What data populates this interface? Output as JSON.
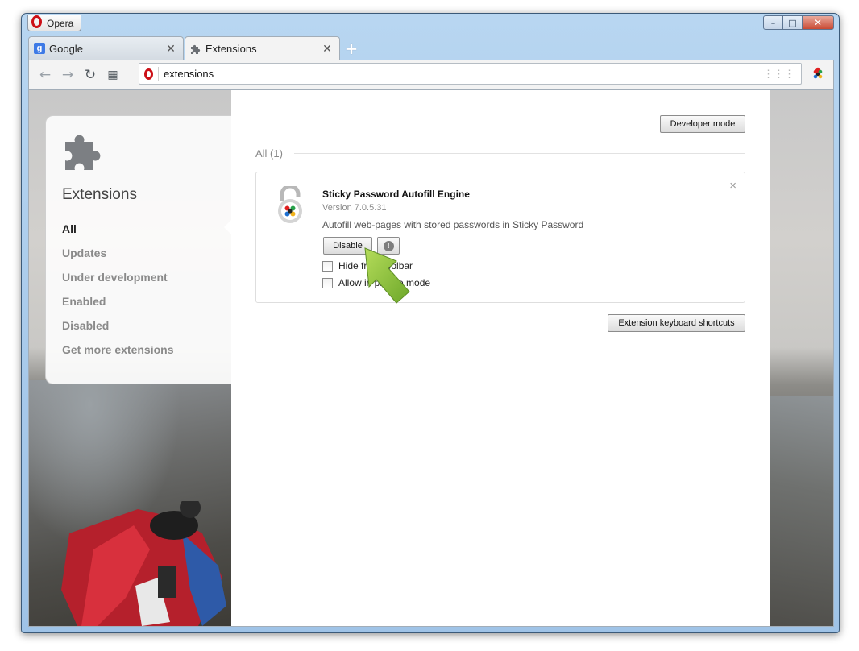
{
  "window": {
    "menu_label": "Opera",
    "controls": {
      "minimize": "–",
      "maximize": "□",
      "close": "✕"
    }
  },
  "tabs": [
    {
      "title": "Google",
      "icon": "google-favicon",
      "close": "✕"
    },
    {
      "title": "Extensions",
      "icon": "puzzle-favicon",
      "close": "✕",
      "active": true
    }
  ],
  "newtab_glyph": "+",
  "toolbar": {
    "back": "←",
    "forward": "→",
    "reload": "↻",
    "speed_dial": "▦",
    "address": "extensions",
    "address_grid": "⋮⋮⋮"
  },
  "sidebar": {
    "title": "Extensions",
    "items": [
      {
        "label": "All",
        "active": true
      },
      {
        "label": "Updates"
      },
      {
        "label": "Under development"
      },
      {
        "label": "Enabled"
      },
      {
        "label": "Disabled"
      },
      {
        "label": "Get more extensions"
      }
    ]
  },
  "main": {
    "developer_mode_label": "Developer mode",
    "section_title": "All (1)",
    "extension": {
      "name": "Sticky Password Autofill Engine",
      "version": "Version 7.0.5.31",
      "description": "Autofill web-pages with stored passwords in Sticky Password",
      "disable_label": "Disable",
      "warning_glyph": "!",
      "remove_glyph": "×",
      "options": [
        {
          "label": "Hide from toolbar",
          "checked": false
        },
        {
          "label": "Allow in private mode",
          "checked": false
        }
      ]
    },
    "keyboard_shortcuts_label": "Extension keyboard shortcuts"
  },
  "colors": {
    "opera_red": "#cc0f16",
    "titlebar": "#b8d6f1",
    "arrow_green": "#8cc63f"
  }
}
